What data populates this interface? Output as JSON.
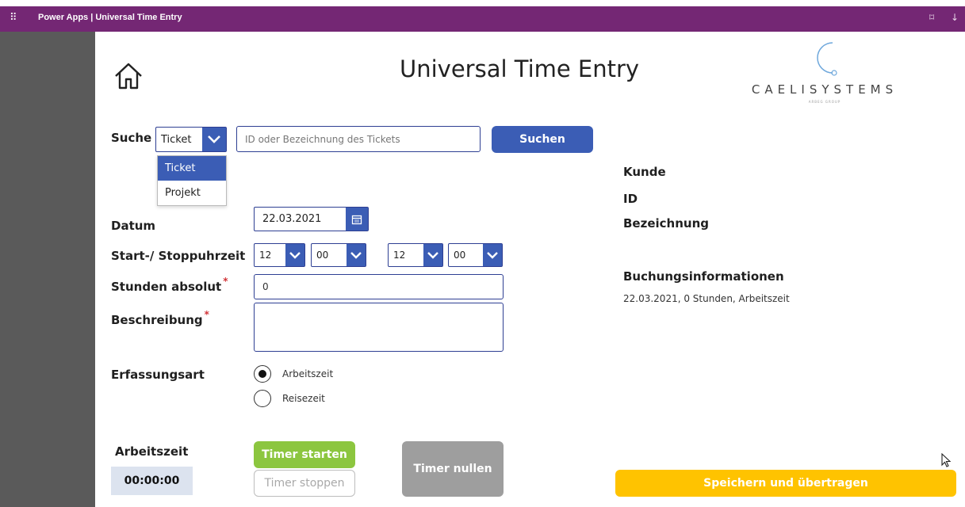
{
  "topbar": {
    "app_title": "Power Apps | Universal Time Entry",
    "waffle_icon": "waffle-icon",
    "bg_color": "#742774"
  },
  "header": {
    "title": "Universal Time Entry",
    "home_icon": "home-icon",
    "logo_text": "CAELISYSTEMS",
    "logo_subtext": "ARBEG GROUP"
  },
  "search": {
    "label": "Suche",
    "type_selected": "Ticket",
    "type_options": [
      "Ticket",
      "Projekt"
    ],
    "placeholder": "ID oder Bezeichnung des Tickets",
    "button_label": "Suchen"
  },
  "form": {
    "date_label": "Datum",
    "date_value": "22.03.2021",
    "time_label": "Start-/ Stoppuhrzeit",
    "start_hour": "12",
    "start_minute": "00",
    "stop_hour": "12",
    "stop_minute": "00",
    "hours_label": "Stunden absolut",
    "hours_value": "0",
    "description_label": "Beschreibung",
    "description_value": "",
    "required_mark": "*",
    "capture_type_label": "Erfassungsart",
    "capture_options": [
      "Arbeitszeit",
      "Reisezeit"
    ],
    "capture_selected": "Arbeitszeit"
  },
  "info": {
    "customer_label": "Kunde",
    "id_label": "ID",
    "name_label": "Bezeichnung",
    "booking_title": "Buchungsinformationen",
    "booking_summary": "22.03.2021, 0 Stunden, Arbeitszeit"
  },
  "timer": {
    "label": "Arbeitszeit",
    "display": "00:00:00",
    "start_label": "Timer starten",
    "stop_label": "Timer stoppen",
    "reset_label": "Timer nullen"
  },
  "save": {
    "label": "Speichern und übertragen"
  },
  "colors": {
    "primary": "#3b5db5",
    "timer_start": "#8cc63f",
    "timer_reset": "#9e9e9e",
    "save": "#ffc300",
    "timer_display_bg": "#dce3ef"
  }
}
